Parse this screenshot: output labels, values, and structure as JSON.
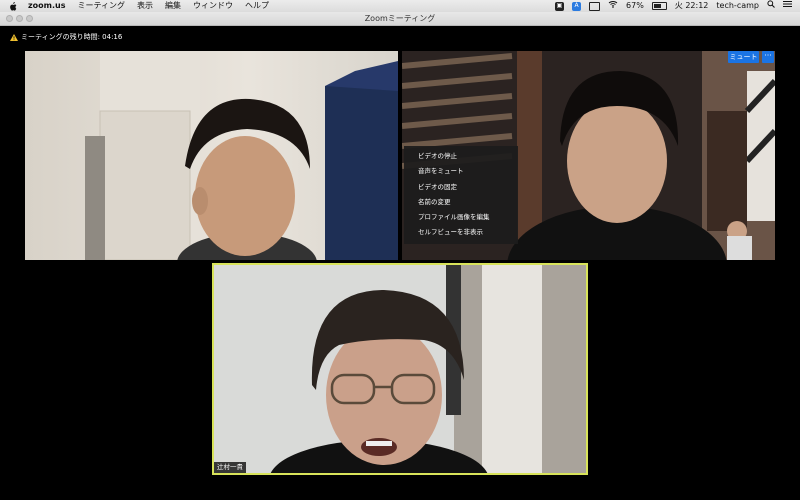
{
  "menubar": {
    "app_name": "zoom.us",
    "menus": [
      "ミーティング",
      "表示",
      "編集",
      "ウィンドウ",
      "ヘルプ"
    ],
    "battery": "67%",
    "clock": "火 22:12",
    "user": "tech-camp"
  },
  "window": {
    "title": "Zoomミーティング"
  },
  "meeting": {
    "timer_text": "ミーティングの残り時間: 04:16"
  },
  "context_menu": {
    "items": [
      "ビデオの停止",
      "音声をミュート",
      "ビデオの固定",
      "名前の変更",
      "プロファイル画像を編集",
      "セルフビューを非表示"
    ]
  },
  "tile_controls": {
    "mute_label": "ミュート",
    "more_label": "···"
  },
  "participants": {
    "active_speaker_name": "辻村一貴"
  }
}
